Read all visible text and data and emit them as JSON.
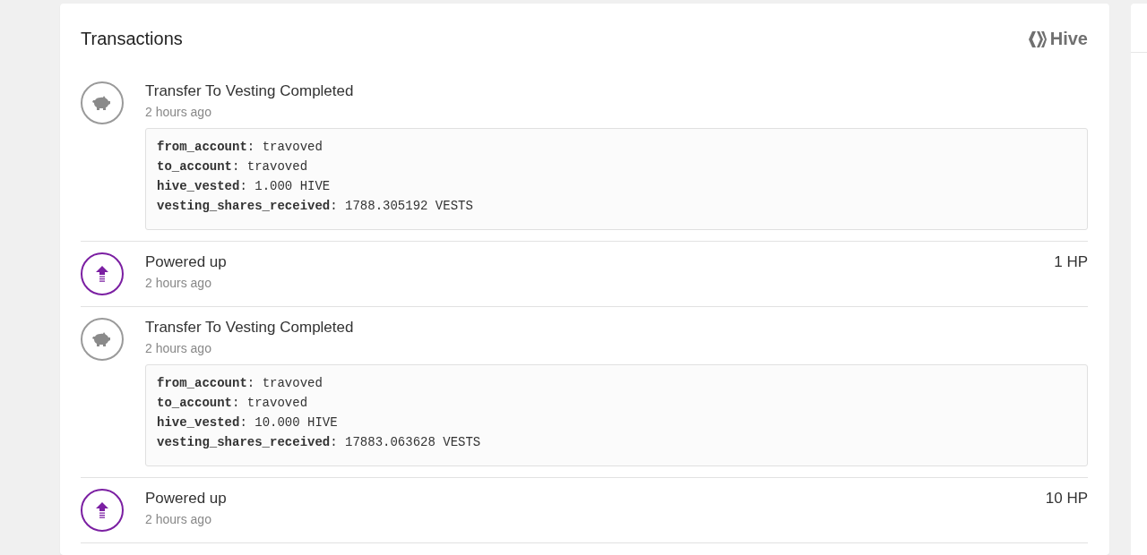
{
  "card": {
    "title": "Transactions",
    "brand": "Hive"
  },
  "transactions": [
    {
      "kind": "vesting",
      "title": "Transfer To Vesting Completed",
      "time": "2 hours ago",
      "details": [
        "**from_account**: travoved",
        "**to_account**: travoved",
        "**hive_vested**: 1.000 HIVE",
        "**vesting_shares_received**: 1788.305192 VESTS"
      ]
    },
    {
      "kind": "power_up",
      "title": "Powered up",
      "time": "2 hours ago",
      "amount": "1 HP"
    },
    {
      "kind": "vesting",
      "title": "Transfer To Vesting Completed",
      "time": "2 hours ago",
      "details": [
        "**from_account**: travoved",
        "**to_account**: travoved",
        "**hive_vested**: 10.000 HIVE",
        "**vesting_shares_received**: 17883.063628 VESTS"
      ]
    },
    {
      "kind": "power_up",
      "title": "Powered up",
      "time": "2 hours ago",
      "amount": "10 HP"
    }
  ]
}
